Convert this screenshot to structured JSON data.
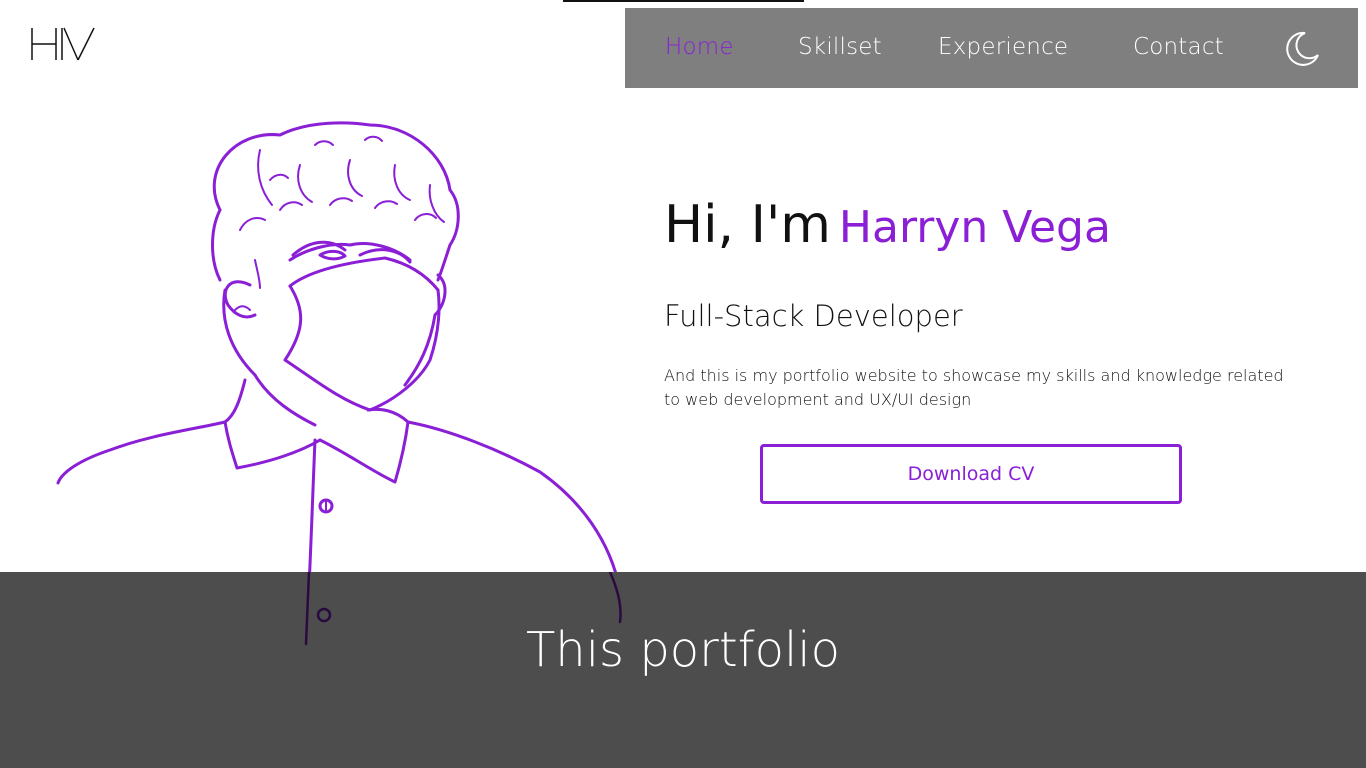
{
  "brand": {
    "logo_text": "HV"
  },
  "nav": {
    "items": [
      {
        "label": "Home",
        "active": true
      },
      {
        "label": "Skillset",
        "active": false
      },
      {
        "label": "Experience",
        "active": false
      },
      {
        "label": "Contact",
        "active": false
      }
    ],
    "theme_toggle_icon": "moon-icon"
  },
  "hero": {
    "greeting": "Hi, I'm",
    "name": "Harryn Vega",
    "role": "Full-Stack Developer",
    "description": "And this is my portfolio website to showcase my skills and knowledge related to web development and UX/UI design",
    "cv_button_label": "Download CV",
    "illustration": "portrait-illustration"
  },
  "section": {
    "title": "This portfolio"
  },
  "colors": {
    "accent": "#8a1fd6",
    "navbar_bg": "#7f7f7f",
    "section_bg": "#4d4d4d",
    "text": "#111111"
  }
}
